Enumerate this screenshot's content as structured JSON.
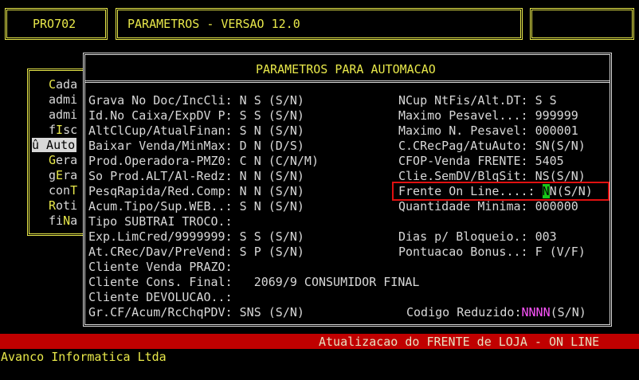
{
  "header": {
    "program_code": "PRO702",
    "title": "PARAMETROS - VERSAO 12.0"
  },
  "background_menu": {
    "items": [
      "Cada",
      "admi",
      "admi",
      "fIsc",
      "û Auto",
      "Gera",
      "gEra",
      "conT",
      "Roti",
      "fiNa"
    ],
    "selected_index": 4
  },
  "dialog": {
    "title": "PARAMETROS PARA AUTOMACAO",
    "left_fields": [
      {
        "label": "Grava No Doc/IncCli:",
        "value": "N S",
        "hint": "(S/N)"
      },
      {
        "label": "Id.No Caixa/ExpDV P:",
        "value": "S S",
        "hint": "(S/N)"
      },
      {
        "label": "AltClCup/AtualFinan:",
        "value": "S N",
        "hint": "(S/N)"
      },
      {
        "label": "Baixar Venda/MinMax:",
        "value": "D N",
        "hint": "(D/S)"
      },
      {
        "label": "Prod.Operadora-PMZ0:",
        "value": "C N",
        "hint": "(C/N/M)"
      },
      {
        "label": "So Prod.ALT/Al-Redz:",
        "value": "N N",
        "hint": "(S/N)"
      },
      {
        "label": "PesqRapida/Red.Comp:",
        "value": "N N",
        "hint": "(S/N)"
      },
      {
        "label": "Acum.Tipo/Sup.WEB..:",
        "value": "S N",
        "hint": "(S/N)"
      },
      {
        "label": "Tipo SUBTRAI TROCO.:",
        "value": "",
        "hint": ""
      },
      {
        "label": "Exp.LimCred/9999999:",
        "value": "S S",
        "hint": "(S/N)"
      },
      {
        "label": "At.CRec/Dav/PreVend:",
        "value": "S P",
        "hint": "(S/N)"
      },
      {
        "label": "Cliente Venda PRAZO:",
        "value": "",
        "hint": ""
      },
      {
        "label": "Cliente Cons. Final:",
        "value": "  2069/9 CONSUMIDOR FINAL",
        "hint": ""
      },
      {
        "label": "Cliente DEVOLUCAO..:",
        "value": "",
        "hint": ""
      },
      {
        "label": "Gr.CF/Acum/RcChqPDV:",
        "value": "SNS",
        "hint": "(S/N)"
      }
    ],
    "right_fields": [
      {
        "label": "NCup NtFis/Alt.DT:",
        "value": "S S",
        "hint": ""
      },
      {
        "label": "Maximo Pesavel...:",
        "value": "999999",
        "hint": ""
      },
      {
        "label": "Maximo N. Pesavel:",
        "value": "000001",
        "hint": ""
      },
      {
        "label": "C.CRecPag/AtuAuto:",
        "value": "SN",
        "hint": "(S/N)"
      },
      {
        "label": "CFOP-Venda FRENTE:",
        "value": "5405",
        "hint": ""
      },
      {
        "label": "Clie.SemDV/BlqSit:",
        "value": "NS",
        "hint": "(S/N)"
      },
      {
        "label": "Frente On Line....:",
        "value_cursor": "N",
        "value": "N",
        "hint": "(S/N)"
      },
      {
        "label": "Quantidade Minima:",
        "value": "000000",
        "hint": ""
      },
      {
        "label": "",
        "value": "",
        "hint": ""
      },
      {
        "label": "Dias p/ Bloqueio.:",
        "value": "003",
        "hint": ""
      },
      {
        "label": "Pontuacao Bonus..:",
        "value": "F",
        "hint": "(V/F)"
      },
      {
        "label": "",
        "value": "",
        "hint": ""
      },
      {
        "label": "",
        "value": "",
        "hint": ""
      },
      {
        "label": "",
        "value": "",
        "hint": ""
      },
      {
        "label": "Codigo Reduzido:",
        "value": "NNNN",
        "hint": "(S/N)"
      }
    ]
  },
  "status_bar": {
    "message": "Atualizacao do FRENTE de LOJA - ON LINE"
  },
  "footer": {
    "company": "Avanco Informatica Ltda"
  },
  "colors": {
    "background": "#000000",
    "accent_yellow": "#e8e84a",
    "status_red": "#c00000",
    "cursor_green": "#18c818",
    "value_magenta": "#ff55ff"
  }
}
